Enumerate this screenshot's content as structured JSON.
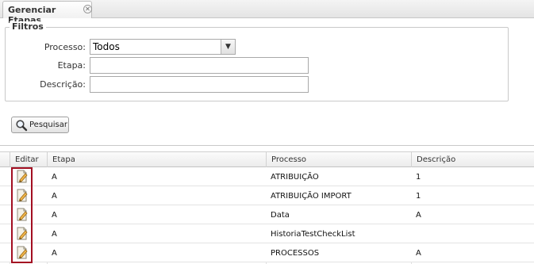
{
  "tabs": [
    {
      "label": "Gerenciar Etapas",
      "close_icon": "close-icon"
    }
  ],
  "filters": {
    "legend": "Filtros",
    "processo": {
      "label": "Processo:",
      "selected": "Todos"
    },
    "etapa": {
      "label": "Etapa:",
      "value": ""
    },
    "descricao": {
      "label": "Descrição:",
      "value": ""
    }
  },
  "search_button": {
    "label": "Pesquisar",
    "icon": "magnifier-icon"
  },
  "grid": {
    "columns": [
      "Editar",
      "Etapa",
      "Processo",
      "Descrição"
    ],
    "edit_icon": "edit-document-icon",
    "rows": [
      {
        "etapa": "A",
        "processo": "ATRIBUIÇÃO",
        "descricao": "1"
      },
      {
        "etapa": "A",
        "processo": "ATRIBUIÇÃO IMPORT",
        "descricao": "1"
      },
      {
        "etapa": "A",
        "processo": "Data",
        "descricao": "A"
      },
      {
        "etapa": "A",
        "processo": "HistoriaTestCheckList",
        "descricao": ""
      },
      {
        "etapa": "A",
        "processo": "PROCESSOS",
        "descricao": "A"
      }
    ]
  },
  "colors": {
    "highlight": "#a30f22",
    "tab_bg": "#f1f1f1",
    "border": "#c9c9c9"
  }
}
